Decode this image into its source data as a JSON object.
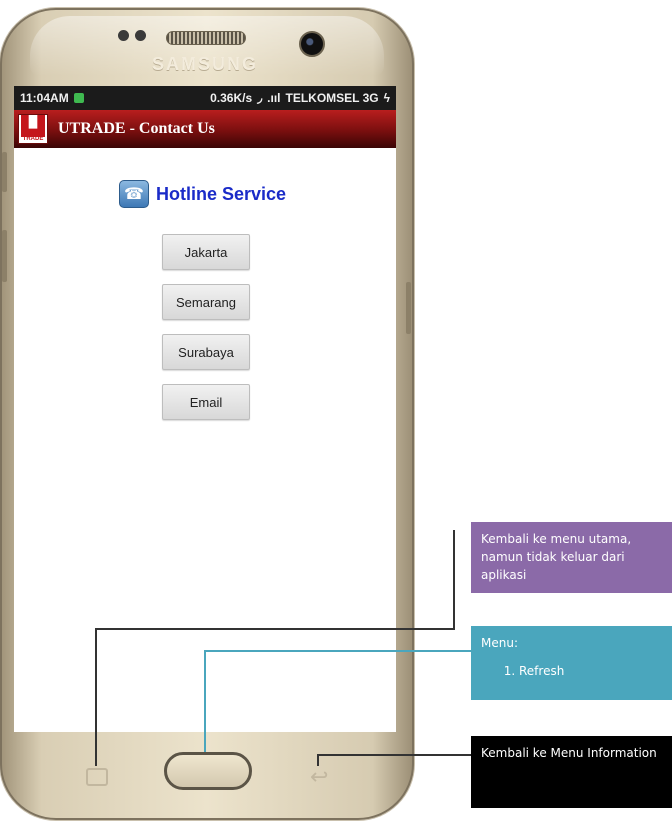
{
  "device": {
    "brand": "SAMSUNG"
  },
  "status_bar": {
    "time": "11:04AM",
    "speed": "0.36K/s",
    "signal": ".ııl",
    "carrier": "TELKOMSEL 3G",
    "charging": "ϟ"
  },
  "app_bar": {
    "logo_text": "TRADE",
    "title": "UTRADE -  Contact Us"
  },
  "hotline": {
    "title": "Hotline Service"
  },
  "buttons": [
    "Jakarta",
    "Semarang",
    "Surabaya",
    "Email"
  ],
  "callouts": {
    "home": "Kembali ke menu utama, namun tidak keluar dari aplikasi",
    "menu_title": "Menu:",
    "menu_items": [
      "Refresh"
    ],
    "back": "Kembali ke Menu Information"
  }
}
